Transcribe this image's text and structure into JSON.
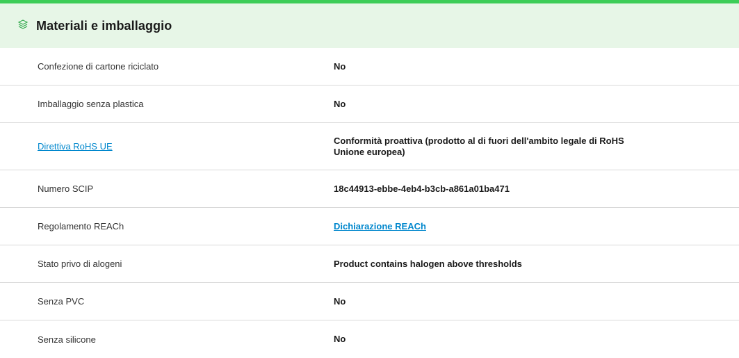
{
  "section": {
    "title": "Materiali e imballaggio",
    "icon": "layers-icon",
    "accent_color": "#3dcd58",
    "header_bg": "#e7f6e7",
    "link_color": "#0087cd"
  },
  "rows": [
    {
      "label": "Confezione di cartone riciclato",
      "value": "No"
    },
    {
      "label": "Imballaggio senza plastica",
      "value": "No"
    },
    {
      "label": "Direttiva RoHS UE",
      "value": "Conformità proattiva (prodotto al di fuori dell'ambito legale di RoHS Unione europea)"
    },
    {
      "label": "Numero SCIP",
      "value": "18c44913-ebbe-4eb4-b3cb-a861a01ba471"
    },
    {
      "label": "Regolamento REACh",
      "value": "Dichiarazione REACh"
    },
    {
      "label": "Stato privo di alogeni",
      "value": "Product contains halogen above thresholds"
    },
    {
      "label": "Senza PVC",
      "value": "No"
    },
    {
      "label": "Senza silicone",
      "value": "No"
    }
  ]
}
